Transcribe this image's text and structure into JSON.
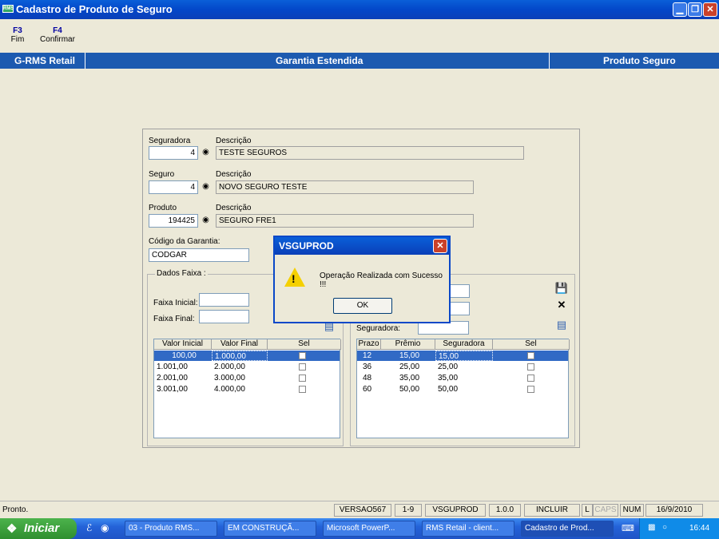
{
  "window": {
    "title": "Cadastro de Produto de Seguro",
    "app_icon_text": "RMS"
  },
  "toolbar": [
    {
      "key": "F3",
      "label": "Fim"
    },
    {
      "key": "F4",
      "label": "Confirmar"
    }
  ],
  "header_band": {
    "left": "G-RMS Retail",
    "center": "Garantia Estendida",
    "right": "Produto Seguro"
  },
  "form": {
    "seguradora": {
      "label": "Seguradora",
      "value": "4",
      "desc_label": "Descrição",
      "desc_value": "TESTE SEGUROS"
    },
    "seguro": {
      "label": "Seguro",
      "value": "4",
      "desc_label": "Descrição",
      "desc_value": "NOVO SEGURO TESTE"
    },
    "produto": {
      "label": "Produto",
      "value": "194425",
      "desc_label": "Descrição",
      "desc_value": "SEGURO FRE1"
    },
    "codigo_garantia": {
      "label": "Código da Garantia:",
      "value": "CODGAR"
    }
  },
  "dados_faixa": {
    "title": "Dados Faixa :",
    "faixa_inicial_label": "Faixa Inicial:",
    "faixa_final_label": "Faixa Final:",
    "columns": [
      "Valor Inicial",
      "Valor Final",
      "Sel"
    ],
    "rows": [
      {
        "inicial": "100,00",
        "final": "1.000,00",
        "selected": true
      },
      {
        "inicial": "1.001,00",
        "final": "2.000,00",
        "selected": false
      },
      {
        "inicial": "2.001,00",
        "final": "3.000,00",
        "selected": false
      },
      {
        "inicial": "3.001,00",
        "final": "4.000,00",
        "selected": false
      }
    ]
  },
  "prazo": {
    "seguradora_label": "Seguradora:",
    "columns": [
      "Prazo",
      "Prêmio",
      "Seguradora",
      "Sel"
    ],
    "rows": [
      {
        "prazo": "12",
        "premio": "15,00",
        "seguradora": "15,00",
        "selected": true
      },
      {
        "prazo": "36",
        "premio": "25,00",
        "seguradora": "25,00",
        "selected": false
      },
      {
        "prazo": "48",
        "premio": "35,00",
        "seguradora": "35,00",
        "selected": false
      },
      {
        "prazo": "60",
        "premio": "50,00",
        "seguradora": "50,00",
        "selected": false
      }
    ]
  },
  "dialog": {
    "title": "VSGUPROD",
    "message": "Operação Realizada com Sucesso !!!",
    "ok_label": "OK"
  },
  "statusbar": {
    "text": "Pronto.",
    "cells": [
      "VERSAO567",
      "1-9",
      "VSGUPROD",
      "1.0.0",
      "INCLUIR",
      "L",
      "CAPS",
      "NUM",
      "16/9/2010"
    ]
  },
  "taskbar": {
    "start_label": "Iniciar",
    "buttons": [
      "03 - Produto RMS...",
      "EM CONSTRUÇÃ...",
      "Microsoft PowerP...",
      "RMS Retail - client...",
      "Cadastro de Prod..."
    ],
    "clock": "16:44"
  }
}
